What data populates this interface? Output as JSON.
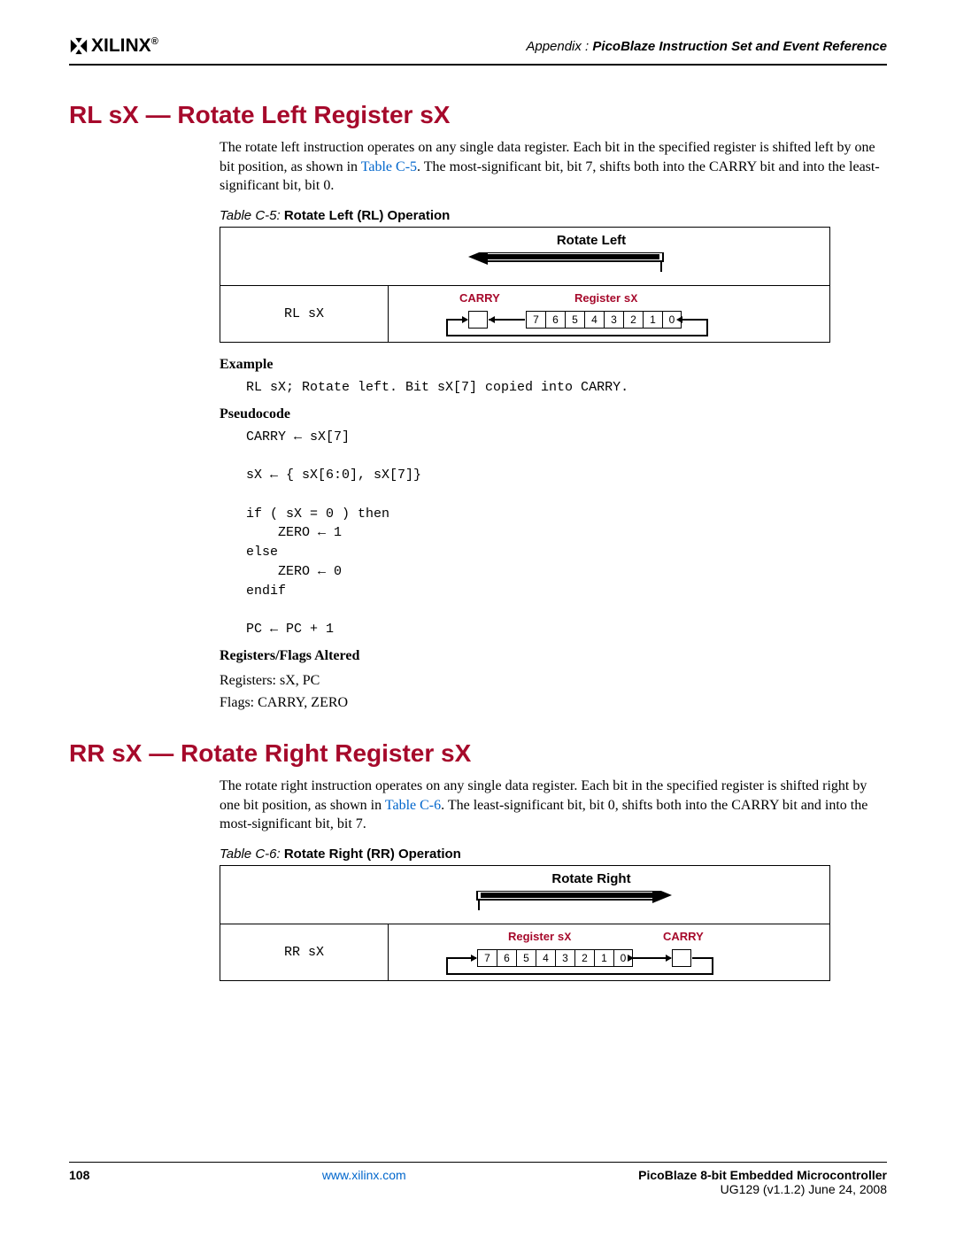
{
  "header": {
    "logo_text": "XILINX",
    "appendix_label": "Appendix :",
    "appendix_title": "PicoBlaze Instruction Set and Event Reference"
  },
  "rl": {
    "heading": "RL sX — Rotate Left Register sX",
    "para_a": "The rotate left instruction operates on any single data register. Each bit in the specified register is shifted left by one bit position, as shown in ",
    "para_link": "Table C-5",
    "para_b": ". The most-significant bit, bit 7, shifts both into the CARRY bit and into the least-significant bit, bit 0.",
    "table_caption_pre": "Table C-5:",
    "table_caption": "Rotate Left (RL) Operation",
    "table_header": "Rotate Left",
    "mnemonic": "RL sX",
    "carry_label": "CARRY",
    "register_label_a": "Register ",
    "register_label_b": "sX",
    "bits": [
      "7",
      "6",
      "5",
      "4",
      "3",
      "2",
      "1",
      "0"
    ],
    "example_label": "Example",
    "example_code": "RL sX; Rotate left. Bit sX[7] copied into CARRY.",
    "pseudo_label": "Pseudocode",
    "pseudo_code": "CARRY ← sX[7]\n\nsX ← { sX[6:0], sX[7]}\n\nif ( sX = 0 ) then\n    ZERO ← 1\nelse\n    ZERO ← 0\nendif\n\nPC ← PC + 1",
    "regflags_label": "Registers/Flags Altered",
    "regflags_a": "Registers: sX, PC",
    "regflags_b": "Flags: CARRY, ZERO"
  },
  "rr": {
    "heading": "RR sX — Rotate Right Register sX",
    "para_a": "The rotate right instruction operates on any single data register. Each bit in the specified register is shifted right by one bit position, as shown in ",
    "para_link": "Table C-6",
    "para_b": ". The least-significant bit, bit 0, shifts both into the CARRY bit and into the most-significant bit, bit 7.",
    "table_caption_pre": "Table C-6:",
    "table_caption": "Rotate Right (RR) Operation",
    "table_header": "Rotate Right",
    "mnemonic": "RR sX",
    "carry_label": "CARRY",
    "register_label_a": "Register ",
    "register_label_b": "sX",
    "bits": [
      "7",
      "6",
      "5",
      "4",
      "3",
      "2",
      "1",
      "0"
    ]
  },
  "footer": {
    "page_number": "108",
    "url": "www.xilinx.com",
    "title": "PicoBlaze 8-bit Embedded Microcontroller",
    "docid": "UG129 (v1.1.2) June 24, 2008"
  }
}
